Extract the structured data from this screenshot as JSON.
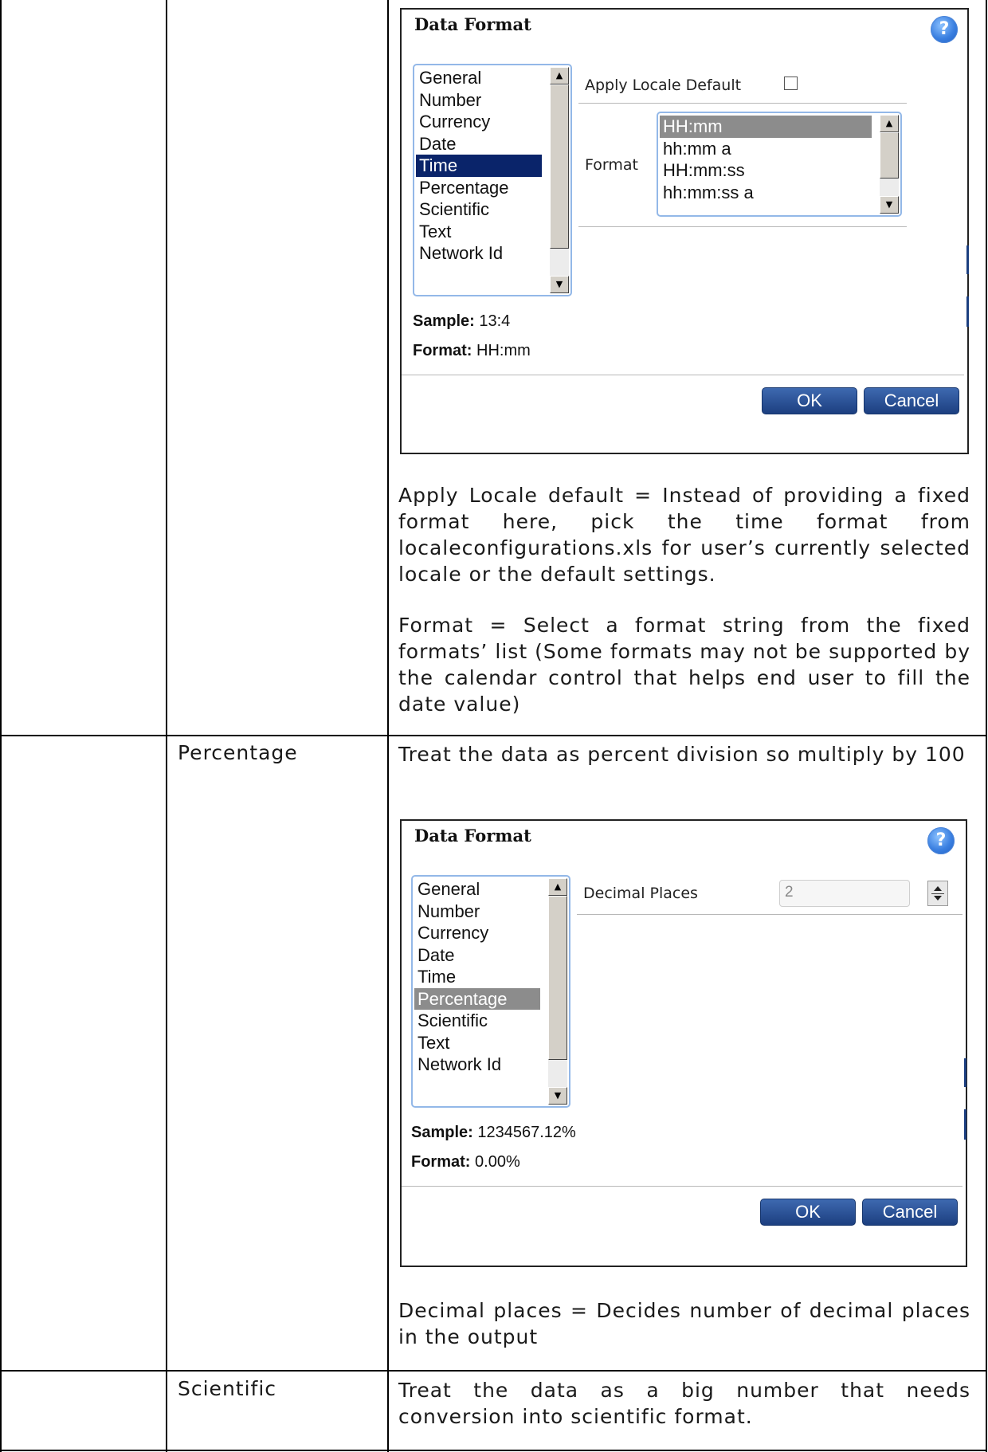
{
  "time_section": {
    "dialog": {
      "title": "Data Format",
      "help_icon": "help-icon",
      "categories": [
        "General",
        "Number",
        "Currency",
        "Date",
        "Time",
        "Percentage",
        "Scientific",
        "Text",
        "Network Id"
      ],
      "selected_category": "Time",
      "apply_locale_label": "Apply Locale Default",
      "apply_locale_checked": false,
      "format_label": "Format",
      "format_options": [
        "HH:mm",
        "hh:mm a",
        "HH:mm:ss",
        "hh:mm:ss a"
      ],
      "selected_format": "HH:mm",
      "sample_label": "Sample:",
      "sample_value": "13:4",
      "format_info_label": "Format:",
      "format_info_value": "HH:mm",
      "ok_label": "OK",
      "cancel_label": "Cancel"
    },
    "desc_apply_locale": "Apply Locale default = Instead of providing a fixed format here, pick the time format from localeconfigurations.xls for user’s currently selected locale or the default settings.",
    "desc_format": "Format = Select a format string from the fixed formats’ list (Some formats may not be supported by the calendar control that helps end user to fill the date value)"
  },
  "percentage_section": {
    "label": "Percentage",
    "intro": "Treat the data as percent division so multiply by 100",
    "dialog": {
      "title": "Data Format",
      "help_icon": "help-icon",
      "categories": [
        "General",
        "Number",
        "Currency",
        "Date",
        "Time",
        "Percentage",
        "Scientific",
        "Text",
        "Network Id"
      ],
      "selected_category": "Percentage",
      "decimal_places_label": "Decimal Places",
      "decimal_places_value": "2",
      "sample_label": "Sample:",
      "sample_value": "1234567.12%",
      "format_info_label": "Format:",
      "format_info_value": "0.00%",
      "ok_label": "OK",
      "cancel_label": "Cancel"
    },
    "desc_decimal": "Decimal places = Decides number of decimal places in the output"
  },
  "scientific_section": {
    "label": "Scientific",
    "intro": "Treat the data as a big number that needs conversion into scientific format."
  }
}
